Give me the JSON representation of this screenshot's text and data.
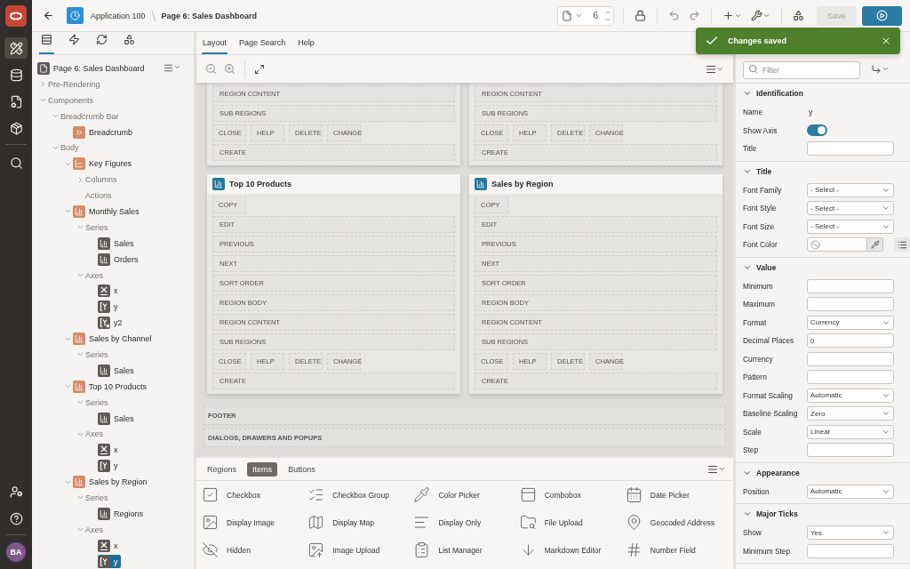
{
  "top_bar": {
    "app": "Application 100",
    "page": "Page 6: Sales Dashboard",
    "page_number": "6",
    "save": {
      "label": "Save",
      "disabled": true
    }
  },
  "toast": {
    "message": "Changes saved"
  },
  "rail": {
    "items": [
      {
        "kind": "designer",
        "selected": true
      },
      {
        "kind": "database",
        "selected": false
      },
      {
        "kind": "file-settings",
        "selected": false
      },
      {
        "kind": "package",
        "selected": false
      },
      {
        "kind": "search",
        "selected": false
      }
    ],
    "bottom": [
      {
        "kind": "user-settings",
        "selected": false
      },
      {
        "kind": "help",
        "selected": false
      }
    ],
    "avatar": "BA"
  },
  "tree_tabs": [
    {
      "kind": "rendering",
      "selected": true
    },
    {
      "kind": "dynamic-actions",
      "selected": false
    },
    {
      "kind": "processing",
      "selected": false
    },
    {
      "kind": "shared",
      "selected": false
    }
  ],
  "tree": {
    "root": {
      "label": "Page 6: Sales Dashboard",
      "selected": false
    },
    "nodes": [
      {
        "label": "Pre-Rendering",
        "kind": "group",
        "expanded": false,
        "selected": false
      },
      {
        "label": "Components",
        "kind": "group",
        "expanded": true,
        "selected": false,
        "children": [
          {
            "label": "Breadcrumb Bar",
            "kind": "group",
            "expanded": true,
            "selected": false,
            "children": [
              {
                "label": "Breadcrumb",
                "kind": "breadcrumb",
                "selected": false
              }
            ]
          },
          {
            "label": "Body",
            "kind": "group",
            "expanded": true,
            "selected": false,
            "children": [
              {
                "label": "Key Figures",
                "kind": "cards",
                "expanded": true,
                "selected": false,
                "children": [
                  {
                    "label": "Columns",
                    "kind": "group",
                    "expanded": false,
                    "selected": false
                  },
                  {
                    "label": "Actions",
                    "kind": "group",
                    "selected": false
                  }
                ]
              },
              {
                "label": "Monthly Sales",
                "kind": "chart",
                "expanded": true,
                "selected": false,
                "children": [
                  {
                    "label": "Series",
                    "kind": "group",
                    "expanded": true,
                    "selected": false,
                    "children": [
                      {
                        "label": "Sales",
                        "kind": "series",
                        "selected": false
                      },
                      {
                        "label": "Orders",
                        "kind": "series",
                        "selected": false
                      }
                    ]
                  },
                  {
                    "label": "Axes",
                    "kind": "group",
                    "expanded": true,
                    "selected": false,
                    "children": [
                      {
                        "label": "x",
                        "kind": "x-axis",
                        "selected": false
                      },
                      {
                        "label": "y",
                        "kind": "y-axis",
                        "selected": false
                      },
                      {
                        "label": "y2",
                        "kind": "y2-axis",
                        "selected": false
                      }
                    ]
                  }
                ]
              },
              {
                "label": "Sales by Channel",
                "kind": "chart",
                "expanded": true,
                "selected": false,
                "children": [
                  {
                    "label": "Series",
                    "kind": "group",
                    "expanded": true,
                    "selected": false,
                    "children": [
                      {
                        "label": "Sales",
                        "kind": "series",
                        "selected": false
                      }
                    ]
                  }
                ]
              },
              {
                "label": "Top 10 Products",
                "kind": "chart",
                "expanded": true,
                "selected": false,
                "children": [
                  {
                    "label": "Series",
                    "kind": "group",
                    "expanded": true,
                    "selected": false,
                    "children": [
                      {
                        "label": "Sales",
                        "kind": "series",
                        "selected": false
                      }
                    ]
                  },
                  {
                    "label": "Axes",
                    "kind": "group",
                    "expanded": true,
                    "selected": false,
                    "children": [
                      {
                        "label": "x",
                        "kind": "x-axis",
                        "selected": false
                      },
                      {
                        "label": "y",
                        "kind": "y-axis",
                        "selected": false
                      }
                    ]
                  }
                ]
              },
              {
                "label": "Sales by Region",
                "kind": "chart",
                "expanded": true,
                "selected": false,
                "children": [
                  {
                    "label": "Series",
                    "kind": "group",
                    "expanded": true,
                    "selected": false,
                    "children": [
                      {
                        "label": "Regions",
                        "kind": "series",
                        "selected": false
                      }
                    ]
                  },
                  {
                    "label": "Axes",
                    "kind": "group",
                    "expanded": true,
                    "selected": false,
                    "children": [
                      {
                        "label": "x",
                        "kind": "x-axis",
                        "selected": false
                      },
                      {
                        "label": "y",
                        "kind": "y-axis",
                        "selected": true
                      }
                    ]
                  }
                ]
              }
            ]
          }
        ]
      }
    ]
  },
  "center_tabs": [
    {
      "label": "Layout",
      "selected": true
    },
    {
      "label": "Page Search",
      "selected": false
    },
    {
      "label": "Help",
      "selected": false
    }
  ],
  "canvas": {
    "cards": [
      {
        "rows": [
          {
            "kind": "slot",
            "label": "REGION CONTENT"
          },
          {
            "kind": "slot",
            "label": "SUB REGIONS"
          },
          {
            "kind": "buttons",
            "labels": [
              "CLOSE",
              "HELP",
              "DELETE",
              "CHANGE"
            ]
          },
          {
            "kind": "slot",
            "label": "CREATE"
          }
        ]
      },
      {
        "rows": [
          {
            "kind": "slot",
            "label": "REGION CONTENT"
          },
          {
            "kind": "slot",
            "label": "SUB REGIONS"
          },
          {
            "kind": "buttons",
            "labels": [
              "CLOSE",
              "HELP",
              "DELETE",
              "CHANGE"
            ]
          },
          {
            "kind": "slot",
            "label": "CREATE"
          }
        ]
      },
      {
        "title": "Top 10 Products",
        "rows": [
          {
            "kind": "buttons",
            "labels": [
              "COPY"
            ]
          },
          {
            "kind": "slot",
            "label": "EDIT"
          },
          {
            "kind": "slot",
            "label": "PREVIOUS"
          },
          {
            "kind": "slot",
            "label": "NEXT"
          },
          {
            "kind": "slot",
            "label": "SORT ORDER"
          },
          {
            "kind": "slot",
            "label": "REGION BODY"
          },
          {
            "kind": "slot",
            "label": "REGION CONTENT"
          },
          {
            "kind": "slot",
            "label": "SUB REGIONS"
          },
          {
            "kind": "buttons",
            "labels": [
              "CLOSE",
              "HELP",
              "DELETE",
              "CHANGE"
            ]
          },
          {
            "kind": "slot",
            "label": "CREATE"
          }
        ]
      },
      {
        "title": "Sales by Region",
        "rows": [
          {
            "kind": "buttons",
            "labels": [
              "COPY"
            ]
          },
          {
            "kind": "slot",
            "label": "EDIT"
          },
          {
            "kind": "slot",
            "label": "PREVIOUS"
          },
          {
            "kind": "slot",
            "label": "NEXT"
          },
          {
            "kind": "slot",
            "label": "SORT ORDER"
          },
          {
            "kind": "slot",
            "label": "REGION BODY"
          },
          {
            "kind": "slot",
            "label": "REGION CONTENT"
          },
          {
            "kind": "slot",
            "label": "SUB REGIONS"
          },
          {
            "kind": "buttons",
            "labels": [
              "CLOSE",
              "HELP",
              "DELETE",
              "CHANGE"
            ]
          },
          {
            "kind": "slot",
            "label": "CREATE"
          }
        ]
      }
    ],
    "sections": [
      "FOOTER",
      "DIALOGS, DRAWERS AND POPUPS"
    ]
  },
  "gallery": {
    "tabs": [
      {
        "label": "Regions",
        "selected": false
      },
      {
        "label": "Items",
        "selected": true
      },
      {
        "label": "Buttons",
        "selected": false
      }
    ],
    "items": [
      {
        "kind": "checkbox",
        "label": "Checkbox"
      },
      {
        "kind": "checkbox-group",
        "label": "Checkbox Group"
      },
      {
        "kind": "color-picker",
        "label": "Color Picker"
      },
      {
        "kind": "combobox",
        "label": "Combobox"
      },
      {
        "kind": "date-picker",
        "label": "Date Picker"
      },
      {
        "kind": "display-image",
        "label": "Display Image"
      },
      {
        "kind": "display-map",
        "label": "Display Map"
      },
      {
        "kind": "display-only",
        "label": "Display Only"
      },
      {
        "kind": "file-upload",
        "label": "File Upload"
      },
      {
        "kind": "geocoded-address",
        "label": "Geocoded Address"
      },
      {
        "kind": "hidden",
        "label": "Hidden"
      },
      {
        "kind": "image-upload",
        "label": "Image Upload"
      },
      {
        "kind": "list-manager",
        "label": "List Manager"
      },
      {
        "kind": "markdown-editor",
        "label": "Markdown Editor"
      },
      {
        "kind": "number-field",
        "label": "Number Field"
      }
    ]
  },
  "properties": {
    "filter": {
      "placeholder": "Filter"
    },
    "sections": [
      {
        "title": "Identification",
        "expanded": true,
        "rows": [
          {
            "label": "Name",
            "kind": "text",
            "value": "y"
          },
          {
            "label": "Show Axis",
            "kind": "toggle",
            "on": true
          },
          {
            "label": "Title",
            "kind": "input"
          }
        ]
      },
      {
        "title": "Title",
        "expanded": true,
        "rows": [
          {
            "label": "Font Family",
            "kind": "select",
            "value": "- Select -"
          },
          {
            "label": "Font Style",
            "kind": "select",
            "value": "- Select -"
          },
          {
            "label": "Font Size",
            "kind": "select",
            "value": "- Select -"
          },
          {
            "label": "Font Color",
            "kind": "color"
          }
        ]
      },
      {
        "title": "Value",
        "expanded": true,
        "rows": [
          {
            "label": "Minimum",
            "kind": "input"
          },
          {
            "label": "Maximum",
            "kind": "input"
          },
          {
            "label": "Format",
            "kind": "select",
            "value": "Currency"
          },
          {
            "label": "Decimal Places",
            "kind": "input",
            "value": "0"
          },
          {
            "label": "Currency",
            "kind": "input"
          },
          {
            "label": "Pattern",
            "kind": "input"
          },
          {
            "label": "Format Scaling",
            "kind": "select",
            "value": "Automatic"
          },
          {
            "label": "Baseline Scaling",
            "kind": "select",
            "value": "Zero"
          },
          {
            "label": "Scale",
            "kind": "select",
            "value": "Linear"
          },
          {
            "label": "Step",
            "kind": "input"
          }
        ]
      },
      {
        "title": "Appearance",
        "expanded": true,
        "rows": [
          {
            "label": "Position",
            "kind": "select",
            "value": "Automatic"
          }
        ]
      },
      {
        "title": "Major Ticks",
        "expanded": true,
        "rows": [
          {
            "label": "Show",
            "kind": "select",
            "value": "Yes"
          },
          {
            "label": "Minimum Step",
            "kind": "input"
          }
        ]
      }
    ]
  }
}
